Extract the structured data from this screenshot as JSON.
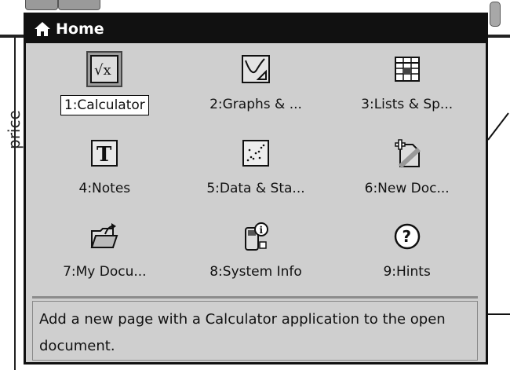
{
  "background": {
    "axis_label": "price"
  },
  "popup": {
    "title": "Home",
    "items": [
      {
        "label": "1:Calculator",
        "icon": "calculator-icon"
      },
      {
        "label": "2:Graphs & ...",
        "icon": "graphs-icon"
      },
      {
        "label": "3:Lists & Sp...",
        "icon": "lists-spreadsheet-icon"
      },
      {
        "label": "4:Notes",
        "icon": "notes-icon"
      },
      {
        "label": "5:Data & Sta...",
        "icon": "data-statistics-icon"
      },
      {
        "label": "6:New Doc...",
        "icon": "new-document-icon"
      },
      {
        "label": "7:My Docu...",
        "icon": "my-documents-icon"
      },
      {
        "label": "8:System Info",
        "icon": "system-info-icon"
      },
      {
        "label": "9:Hints",
        "icon": "hints-icon"
      }
    ],
    "selected_index": 0,
    "description": "Add a new page with a Calculator application to the open document."
  }
}
